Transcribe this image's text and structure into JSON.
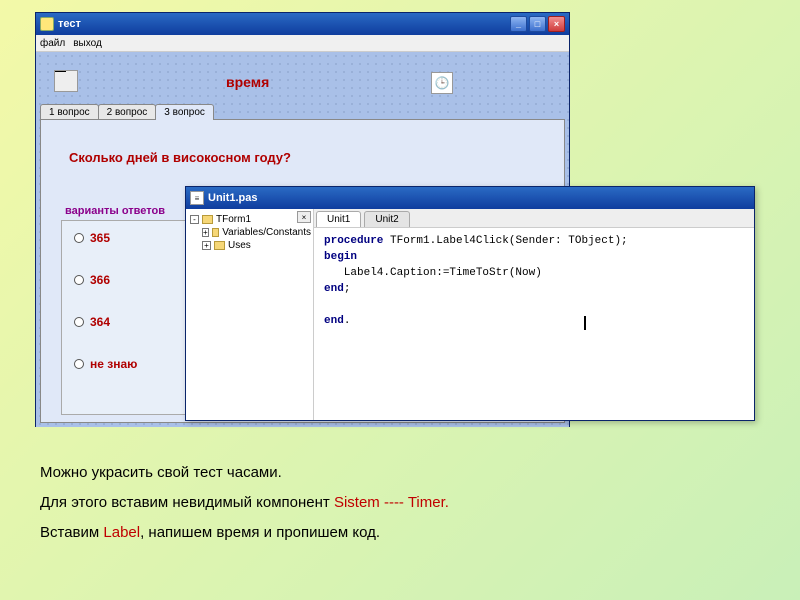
{
  "main_window": {
    "title": "тест",
    "menu": {
      "item1": "файл",
      "item2": "выход"
    },
    "labels": {
      "time": "время"
    },
    "tabs": {
      "t1": "1 вопрос",
      "t2": "2 вопрос",
      "t3": "3 вопрос"
    },
    "question": "Сколько дней в високосном году?",
    "variants_label": "варианты ответов",
    "answers": [
      "365",
      "366",
      "364",
      "не знаю"
    ]
  },
  "editor_window": {
    "title": "Unit1.pas",
    "tree": {
      "item1": "TForm1",
      "item2": "Variables/Constants",
      "item3": "Uses"
    },
    "tabs": {
      "t1": "Unit1",
      "t2": "Unit2"
    },
    "code": {
      "l1_kw": "procedure",
      "l1_rest": " TForm1.Label4Click(Sender: TObject);",
      "l2": "begin",
      "l3": "   Label4.Caption:=TimeToStr(Now)",
      "l4_kw": "end",
      "l4_rest": ";",
      "l5_kw": "end",
      "l5_rest": "."
    }
  },
  "explain": {
    "line1": "Можно украсить свой тест часами.",
    "line2a": "Для этого вставим невидимый компонент  ",
    "line2b": "Sistem ---- Timer.",
    "line3a": "Вставим  ",
    "line3b": "Label",
    "line3c": ", напишем время и пропишем код."
  }
}
